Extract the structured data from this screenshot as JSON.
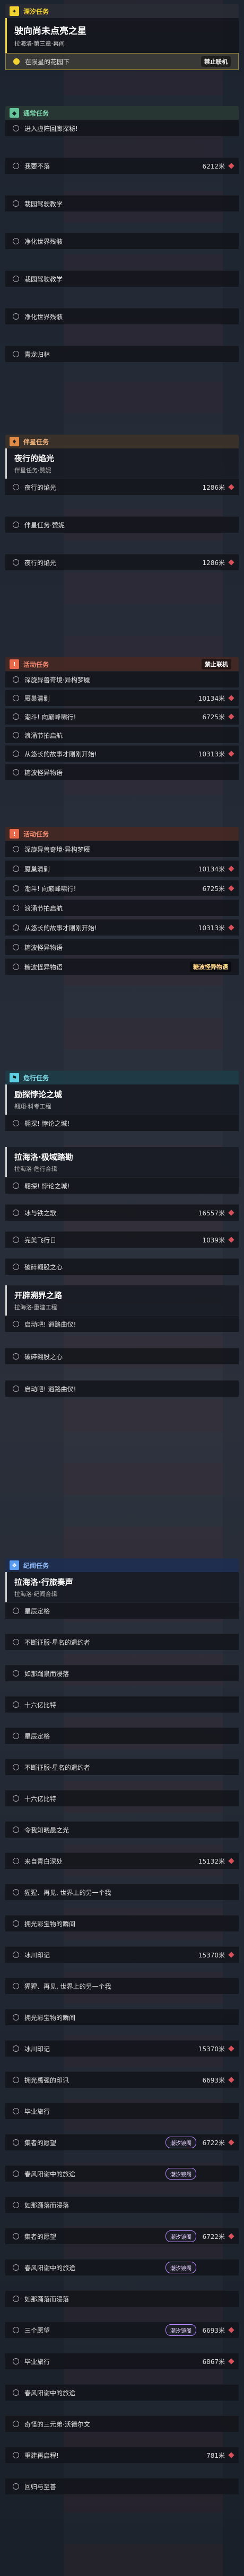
{
  "trail": {
    "header": "湮汐任务",
    "quest_title": "驶向尚未点亮之星",
    "quest_sub": "拉海洛·第三章·幕间",
    "focus_row": "在陨星的花园下"
  },
  "common": {
    "header": "通常任务",
    "items": [
      {
        "label": "进入虚阵回廊探秘!",
        "dist": ""
      },
      {
        "label": "我要不落",
        "dist": "6212米"
      },
      {
        "label": "栽园驾驶教学",
        "dist": ""
      },
      {
        "label": "净化世界残骸",
        "dist": ""
      },
      {
        "label": "栽园驾驶教学",
        "dist": ""
      },
      {
        "label": "净化世界残骸",
        "dist": ""
      },
      {
        "label": "青龙归林",
        "dist": ""
      }
    ]
  },
  "side": {
    "header": "伴星任务",
    "sub_title": "夜行的焰光",
    "sub_meta": "伴星任务·赞妮",
    "items": [
      {
        "label": "夜行的焰光",
        "dist": "1286米"
      },
      {
        "label": "伴星任务·赞妮",
        "dist": ""
      },
      {
        "label": "夜行的焰光",
        "dist": "1286米"
      }
    ]
  },
  "activity": {
    "header": "活动任务",
    "items": [
      {
        "label": "深旋异兽奇境·异构梦魇",
        "dist": ""
      },
      {
        "label": "魇巢清剿",
        "dist": "10134米"
      },
      {
        "label": "潮斗! 向巅峰啸行!",
        "dist": "6725米"
      },
      {
        "label": "浪涌节拍启航",
        "dist": ""
      },
      {
        "label": "从悠长的故事才刚刚开始!",
        "dist": "10313米"
      },
      {
        "label": "糖波怪异物语",
        "dist": ""
      }
    ],
    "items2": [
      {
        "label": "深旋异兽奇境·异构梦魇",
        "dist": ""
      },
      {
        "label": "魇巢清剿",
        "dist": "10134米"
      },
      {
        "label": "潮斗! 向巅峰啸行!",
        "dist": "6725米"
      },
      {
        "label": "浪涌节拍启航",
        "dist": ""
      },
      {
        "label": "从悠长的故事才刚刚开始!",
        "dist": "10313米"
      },
      {
        "label": "糖波怪异物语",
        "dist": ""
      }
    ]
  },
  "daily": {
    "header": "危行任务",
    "block1_title": "励探悖论之城",
    "block1_meta": "翱翔·科考工程",
    "block1_items": [
      {
        "label": "翱探! 悖论之城!",
        "dist": ""
      }
    ],
    "block2_title": "拉海洛·极域踏勘",
    "block2_meta": "拉海洛·危行合辑",
    "block2_items": [
      {
        "label": "翱探! 悖论之城!",
        "dist": ""
      },
      {
        "label": "冰与铁之歌",
        "dist": "16557米"
      },
      {
        "label": "完美飞行日",
        "dist": "1039米"
      },
      {
        "label": "破碎翱股之心",
        "dist": ""
      }
    ],
    "block3_title": "开辟溯界之路",
    "block3_meta": "拉海洛·重建工程",
    "block3_items": [
      {
        "label": "启动吧! 逍路曲仪!",
        "dist": ""
      },
      {
        "label": "破碎翱股之心",
        "dist": ""
      },
      {
        "label": "启动吧! 逍路曲仪!",
        "dist": ""
      }
    ]
  },
  "chronicle": {
    "header": "纪闻任务",
    "title": "拉海洛·行旅奏声",
    "meta": "拉海洛·纪闻合辑",
    "items": [
      {
        "label": "星辰定格",
        "dist": ""
      },
      {
        "label": "不断征服·星名的遗约者",
        "dist": ""
      },
      {
        "label": "如那踊泉而浸落",
        "dist": ""
      },
      {
        "label": "十六亿比特",
        "dist": ""
      },
      {
        "label": "星辰定格",
        "dist": ""
      },
      {
        "label": "不断征服·星名的遗约者",
        "dist": ""
      },
      {
        "label": "十六亿比特",
        "dist": ""
      },
      {
        "label": "令我知晓晨之光",
        "dist": ""
      },
      {
        "label": "来自青白深处",
        "dist": "15132米"
      },
      {
        "label": "猩猩、再见, 世界上的另一个我",
        "dist": ""
      },
      {
        "label": "拥光彩宝物的瞬间",
        "dist": ""
      },
      {
        "label": "冰川印记",
        "dist": "15370米"
      },
      {
        "label": "猩猩、再见, 世界上的另一个我",
        "dist": ""
      },
      {
        "label": "拥光彩宝物的瞬间",
        "dist": ""
      },
      {
        "label": "冰川印记",
        "dist": "15370米"
      },
      {
        "label": "拥光禹强的印讯",
        "dist": "6693米"
      },
      {
        "label": "毕业旅行",
        "dist": ""
      },
      {
        "label": "集者的愿望",
        "dist": "6722米"
      },
      {
        "label": "春风阳谢中的旅途",
        "dist": ""
      },
      {
        "label": "如那踊落而浸落",
        "dist": ""
      },
      {
        "label": "集者的愿望",
        "dist": "6722米"
      },
      {
        "label": "春风阳谢中的旅途",
        "dist": ""
      },
      {
        "label": "如那踊落而浸落",
        "dist": ""
      },
      {
        "label": "三个愿望",
        "dist": "6693米"
      },
      {
        "label": "毕业旅行",
        "dist": "6867米"
      },
      {
        "label": "春风阳谢中的旅途",
        "dist": ""
      },
      {
        "label": "奇怪的三元弟·沃德尔文",
        "dist": ""
      },
      {
        "label": "重建再启程!",
        "dist": "781米"
      },
      {
        "label": "回归与至善",
        "dist": ""
      }
    ]
  },
  "badges": {
    "watermark": "禁止联机",
    "gold_mark": "糖波怪异物语",
    "chip": "潮汐镜阁"
  }
}
